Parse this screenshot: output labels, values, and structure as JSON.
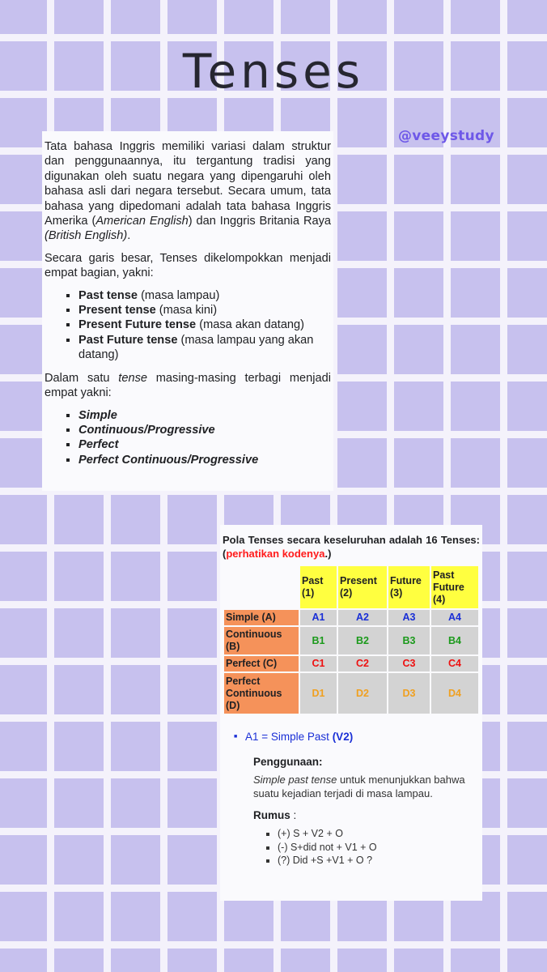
{
  "title": "Tenses",
  "handle": "@veeystudy",
  "card1": {
    "p1_a": "Tata bahasa Inggris memiliki variasi dalam struktur dan penggunaannya, itu tergantung tradisi yang digunakan oleh suatu negara yang dipengaruhi oleh bahasa asli dari negara tersebut. Secara umum, tata bahasa yang dipedomani adalah tata bahasa Inggris Amerika (",
    "p1_am": "American English",
    "p1_b": ") dan Inggris Britania Raya ",
    "p1_br": "(British English)",
    "p1_c": ".",
    "p2": "Secara garis besar, Tenses dikelompokkan menjadi empat bagian, yakni:",
    "tenses": [
      {
        "name": "Past tense",
        "desc": " (masa lampau)"
      },
      {
        "name": "Present tense",
        "desc": " (masa kini)"
      },
      {
        "name": "Present Future tense",
        "desc": " (masa akan datang)"
      },
      {
        "name": "Past Future tense",
        "desc": " (masa lampau yang akan datang)"
      }
    ],
    "p3_a": "Dalam satu ",
    "p3_em": "tense",
    "p3_b": " masing-masing terbagi menjadi empat yakni:",
    "aspects": [
      "Simple",
      "Continuous/Progressive",
      "Perfect",
      "Perfect Continuous/Progressive"
    ]
  },
  "card2": {
    "intro_a": "Pola Tenses secara keseluruhan adalah 16 Tenses: (",
    "intro_red": "perhatikan kodenya",
    "intro_b": ".)",
    "headers": [
      "Past (1)",
      "Present (2)",
      "Future (3)",
      "Past Future (4)"
    ],
    "rows": [
      {
        "label": "Simple (A)",
        "cells": [
          "A1",
          "A2",
          "A3",
          "A4"
        ]
      },
      {
        "label": "Continuous (B)",
        "cells": [
          "B1",
          "B2",
          "B3",
          "B4"
        ]
      },
      {
        "label": "Perfect (C)",
        "cells": [
          "C1",
          "C2",
          "C3",
          "C4"
        ]
      },
      {
        "label": "Perfect Continuous (D)",
        "cells": [
          "D1",
          "D2",
          "D3",
          "D4"
        ]
      }
    ],
    "a1_text": "A1 = Simple Past ",
    "a1_bold": "(V2)",
    "penggunaan_label": "Penggunaan:",
    "usage_em": "Simple past tense",
    "usage_text": " untuk menunjukkan bahwa suatu kejadian terjadi di masa lampau.",
    "rumus_label": "Rumus",
    "rumus_colon": " :",
    "formulas": [
      "(+) S + V2 + O",
      "(-) S+did not + V1 + O",
      "(?) Did +S +V1 + O ?"
    ]
  },
  "colors": {
    "background": "#c7c1ee",
    "grid": "#f4f2fb",
    "handle": "#6e58e8",
    "header_yellow": "#ffff40",
    "row_orange": "#f5925a",
    "cell_grey": "#d3d3d3",
    "code_a_blue": "#1a2fd6",
    "code_b_green": "#1b9a1b",
    "code_c_red": "#ee1111",
    "code_d_orange": "#f0a020"
  }
}
